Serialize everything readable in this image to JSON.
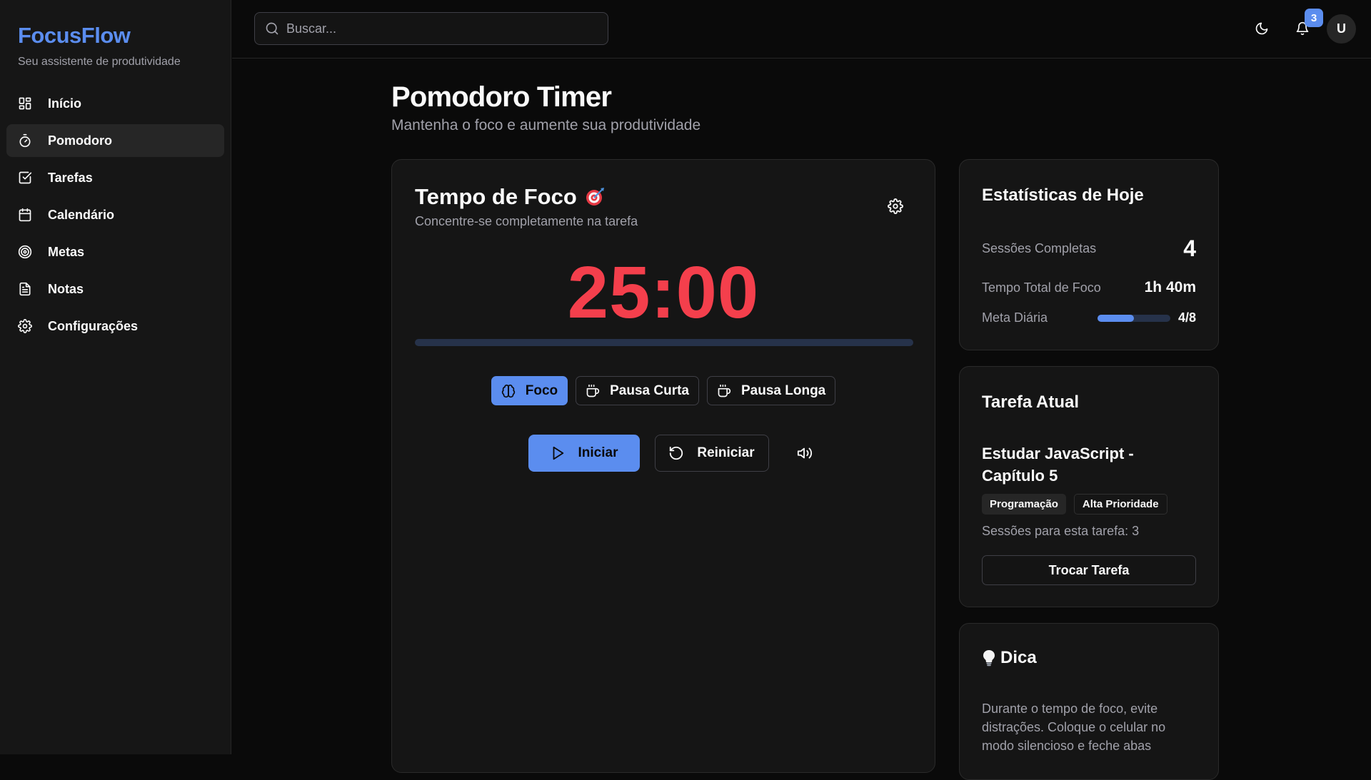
{
  "app": {
    "name": "FocusFlow",
    "tagline": "Seu assistente de produtividade"
  },
  "sidebar": {
    "items": [
      {
        "label": "Início",
        "icon": "grid-icon"
      },
      {
        "label": "Pomodoro",
        "icon": "timer-icon",
        "active": true
      },
      {
        "label": "Tarefas",
        "icon": "checkbox-icon"
      },
      {
        "label": "Calendário",
        "icon": "calendar-icon"
      },
      {
        "label": "Metas",
        "icon": "target-icon"
      },
      {
        "label": "Notas",
        "icon": "document-icon"
      },
      {
        "label": "Configurações",
        "icon": "gear-icon"
      }
    ]
  },
  "header": {
    "search_placeholder": "Buscar...",
    "notification_count": "3",
    "avatar_initial": "U"
  },
  "page": {
    "title": "Pomodoro Timer",
    "subtitle": "Mantenha o foco e aumente sua produtividade"
  },
  "timer": {
    "title": "Tempo de Foco",
    "subtitle": "Concentre-se completamente na tarefa",
    "time": "25:00",
    "progress": 0,
    "modes": [
      {
        "label": "Foco",
        "icon": "brain-icon",
        "active": true
      },
      {
        "label": "Pausa Curta",
        "icon": "coffee-icon"
      },
      {
        "label": "Pausa Longa",
        "icon": "coffee-icon"
      }
    ],
    "start_label": "Iniciar",
    "reset_label": "Reiniciar"
  },
  "stats": {
    "title": "Estatísticas de Hoje",
    "sessions_label": "Sessões Completas",
    "sessions_value": "4",
    "total_label": "Tempo Total de Foco",
    "total_value": "1h 40m",
    "goal_label": "Meta Diária",
    "goal_value": "4/8",
    "goal_progress": 0.5
  },
  "task": {
    "title": "Tarefa Atual",
    "name": "Estudar JavaScript - Capítulo 5",
    "tags": [
      "Programação",
      "Alta Prioridade"
    ],
    "sessions": "Sessões para esta tarefa: 3",
    "swap_label": "Trocar Tarefa"
  },
  "tip": {
    "title": "Dica",
    "text": "Durante o tempo de foco, evite distrações. Coloque o celular no modo silencioso e feche abas"
  },
  "colors": {
    "accent": "#5b8def",
    "timer": "#f43f4c",
    "background": "#0a0a0a",
    "card": "#151515",
    "sidebar": "#161616"
  }
}
